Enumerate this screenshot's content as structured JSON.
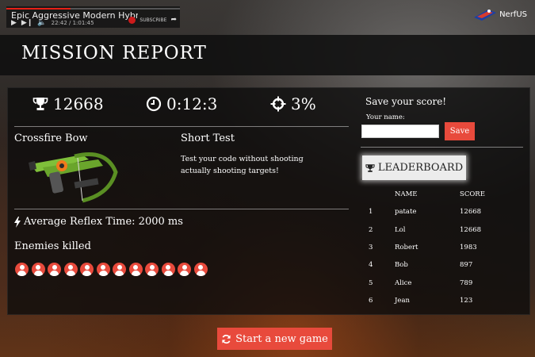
{
  "video": {
    "title": "Epic Aggressive Modern Hybrid-Orch...",
    "time": "22:42 / 1:01:45",
    "subscribe": "SUBSCRIBE",
    "progress": 0.37
  },
  "brand": {
    "name": "NerfUS"
  },
  "header": {
    "title": "MISSION REPORT"
  },
  "stats": {
    "score": "12668",
    "time": "0:12:3",
    "accuracy": "3%"
  },
  "weapon": {
    "name": "Crossfire Bow"
  },
  "test": {
    "title": "Short Test",
    "description": "Test your code without shooting actually shooting targets!"
  },
  "reflex": {
    "label": "Average Reflex Time: 2000 ms"
  },
  "enemies": {
    "title": "Enemies killed",
    "count": 12
  },
  "save": {
    "title": "Save your score!",
    "name_label": "Your name:",
    "name_value": "",
    "button": "Save"
  },
  "leaderboard": {
    "button": "LEADERBOARD",
    "headers": [
      "",
      "NAME",
      "SCORE"
    ],
    "rows": [
      [
        "1",
        "patate",
        "12668"
      ],
      [
        "2",
        "Lol",
        "12668"
      ],
      [
        "3",
        "Robert",
        "1983"
      ],
      [
        "4",
        "Bob",
        "897"
      ],
      [
        "5",
        "Alice",
        "789"
      ],
      [
        "6",
        "Jean",
        "123"
      ]
    ]
  },
  "actions": {
    "start_new_game": "Start a new game"
  },
  "colors": {
    "accent": "#e84a3c",
    "panel": "#0c0c0c",
    "header": "#0f0f0f"
  },
  "icons": {
    "score": "trophy-icon",
    "time": "clock-icon",
    "accuracy": "crosshair-icon",
    "reflex": "bolt-icon",
    "enemy": "user-icon",
    "leaderboard": "trophy-icon",
    "restart": "refresh-icon"
  }
}
